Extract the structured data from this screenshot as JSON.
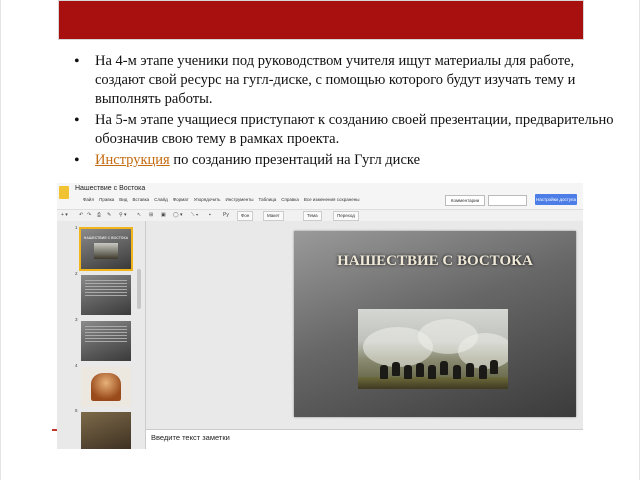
{
  "bullets": [
    {
      "text": "На 4-м этапе ученики под руководством учителя ищут материалы для работе, создают свой ресурс на гугл-диске, с помощью которого будут изучать тему и выполнять работы."
    },
    {
      "text": "На 5-м этапе учащиеся приступают к созданию своей презентации, предварительно обозначив свою тему в рамках проекта."
    },
    {
      "link": "Инструкция",
      "text": " по созданию презентаций на Гугл диске"
    }
  ],
  "app": {
    "doc_title": "Нашествие с Востока",
    "menu": [
      "Файл",
      "Правка",
      "Вид",
      "Вставка",
      "Слайд",
      "Формат",
      "Упорядочить",
      "Инструменты",
      "Таблица",
      "Справка",
      "Все изменения сохранены"
    ],
    "comments_label": "Комментарии",
    "present_label": "",
    "share_label": "Настройки доступа",
    "toolbar": {
      "font": "Ру",
      "layout": "Фон",
      "theme": "Макет",
      "transition": "Тема",
      "extra": "Переход"
    },
    "slides": [
      {
        "number": "1",
        "title": "НАШЕСТВИЕ С ВОСТОКА"
      },
      {
        "number": "2"
      },
      {
        "number": "3"
      },
      {
        "number": "4"
      },
      {
        "number": "5"
      }
    ],
    "main_slide_title": "НАШЕСТВИЕ С ВОСТОКА",
    "notes_placeholder": "Введите текст заметки"
  },
  "colors": {
    "banner": "#a80f0f",
    "link": "#c46a10",
    "share": "#4d7ee8",
    "selection": "#f1b41a"
  }
}
